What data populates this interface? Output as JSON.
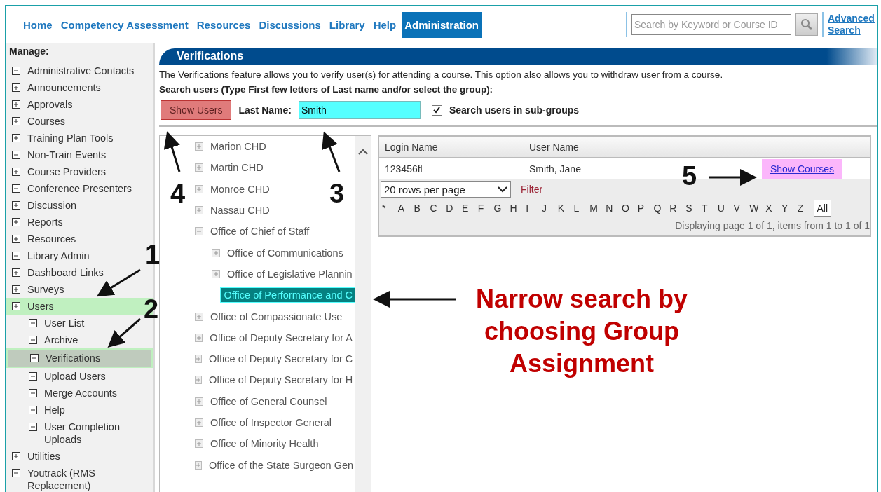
{
  "nav": {
    "items": [
      {
        "label": "Home",
        "selected": false
      },
      {
        "label": "Competency Assessment",
        "selected": false
      },
      {
        "label": "Resources",
        "selected": false
      },
      {
        "label": "Discussions",
        "selected": false
      },
      {
        "label": "Library",
        "selected": false
      },
      {
        "label": "Help",
        "selected": false
      },
      {
        "label": "Administration",
        "selected": true
      }
    ],
    "search_placeholder": "Search by Keyword or Course ID",
    "advanced_search": "Advanced Search"
  },
  "sidebar": {
    "title": "Manage:",
    "items": [
      {
        "label": "Administrative Contacts",
        "expanded": true,
        "selected": false
      },
      {
        "label": "Announcements",
        "expanded": false,
        "selected": false
      },
      {
        "label": "Approvals",
        "expanded": false,
        "selected": false
      },
      {
        "label": "Courses",
        "expanded": false,
        "selected": false
      },
      {
        "label": "Training Plan Tools",
        "expanded": false,
        "selected": false
      },
      {
        "label": "Non-Train Events",
        "expanded": true,
        "selected": false
      },
      {
        "label": "Course Providers",
        "expanded": false,
        "selected": false
      },
      {
        "label": "Conference Presenters",
        "expanded": true,
        "selected": false
      },
      {
        "label": "Discussion",
        "expanded": false,
        "selected": false
      },
      {
        "label": "Reports",
        "expanded": false,
        "selected": false
      },
      {
        "label": "Resources",
        "expanded": false,
        "selected": false
      },
      {
        "label": "Library Admin",
        "expanded": true,
        "selected": false
      },
      {
        "label": "Dashboard Links",
        "expanded": false,
        "selected": false
      },
      {
        "label": "Surveys",
        "expanded": false,
        "selected": false
      },
      {
        "label": "Users",
        "expanded": false,
        "selected": true,
        "children": [
          {
            "label": "User List",
            "expanded": true,
            "selected": false
          },
          {
            "label": "Archive",
            "expanded": true,
            "selected": false
          },
          {
            "label": "Verifications",
            "expanded": true,
            "selected": true
          },
          {
            "label": "Upload Users",
            "expanded": true,
            "selected": false
          },
          {
            "label": "Merge Accounts",
            "expanded": true,
            "selected": false
          },
          {
            "label": "Help",
            "expanded": true,
            "selected": false
          },
          {
            "label": "User Completion Uploads",
            "expanded": true,
            "selected": false
          }
        ]
      },
      {
        "label": "Utilities",
        "expanded": false,
        "selected": false
      },
      {
        "label": "Youtrack (RMS Replacement)",
        "expanded": true,
        "selected": false
      }
    ]
  },
  "panel": {
    "title": "Verifications",
    "description": "The Verifications feature allows you to verify user(s) for attending a course. This option also allows you to withdraw user from a course.",
    "search_prompt": "Search users (Type First few letters of Last name and/or select the group):",
    "show_users": "Show Users",
    "last_name_label": "Last Name:",
    "last_name_value": "Smith",
    "subgroups": {
      "label": "Search users in sub-groups",
      "checked": true
    }
  },
  "tree": [
    {
      "label": "Marion CHD",
      "expanded": false,
      "selected": false
    },
    {
      "label": "Martin CHD",
      "expanded": false,
      "selected": false
    },
    {
      "label": "Monroe CHD",
      "expanded": false,
      "selected": false
    },
    {
      "label": "Nassau CHD",
      "expanded": false,
      "selected": false
    },
    {
      "label": "Office of Chief of Staff",
      "expanded": true,
      "selected": false,
      "children": [
        {
          "label": "Office of Communications",
          "expanded": false,
          "selected": false
        },
        {
          "label": "Office of Legislative Plannin",
          "expanded": false,
          "selected": false
        },
        {
          "label": "Office of Performance and C",
          "kind": "leaf",
          "selected": true
        }
      ]
    },
    {
      "label": "Office of Compassionate Use",
      "expanded": false,
      "selected": false
    },
    {
      "label": "Office of Deputy Secretary for A",
      "expanded": false,
      "selected": false
    },
    {
      "label": "Office of Deputy Secretary for C",
      "expanded": false,
      "selected": false
    },
    {
      "label": "Office of Deputy Secretary for H",
      "expanded": false,
      "selected": false
    },
    {
      "label": "Office of General Counsel",
      "expanded": false,
      "selected": false
    },
    {
      "label": "Office of Inspector General",
      "expanded": false,
      "selected": false
    },
    {
      "label": "Office of Minority Health",
      "expanded": false,
      "selected": false
    },
    {
      "label": "Office of the State Surgeon Gen",
      "expanded": false,
      "selected": false
    }
  ],
  "grid": {
    "columns": [
      "Login Name",
      "User Name"
    ],
    "rows": [
      {
        "login": "123456fl",
        "user": "Smith, Jane",
        "action": "Show Courses"
      }
    ],
    "rows_per_page": "20 rows per page",
    "filter": "Filter",
    "letters": [
      "*",
      "A",
      "B",
      "C",
      "D",
      "E",
      "F",
      "G",
      "H",
      "I",
      "J",
      "K",
      "L",
      "M",
      "N",
      "O",
      "P",
      "Q",
      "R",
      "S",
      "T",
      "U",
      "V",
      "W",
      "X",
      "Y",
      "Z"
    ],
    "all": "All",
    "paging": "Displaying page 1 of 1, items from 1 to 1 of 1"
  },
  "annotations": {
    "steps": [
      "1",
      "2",
      "3",
      "4",
      "5"
    ],
    "callout": "Narrow search by choosing Group Assignment"
  }
}
